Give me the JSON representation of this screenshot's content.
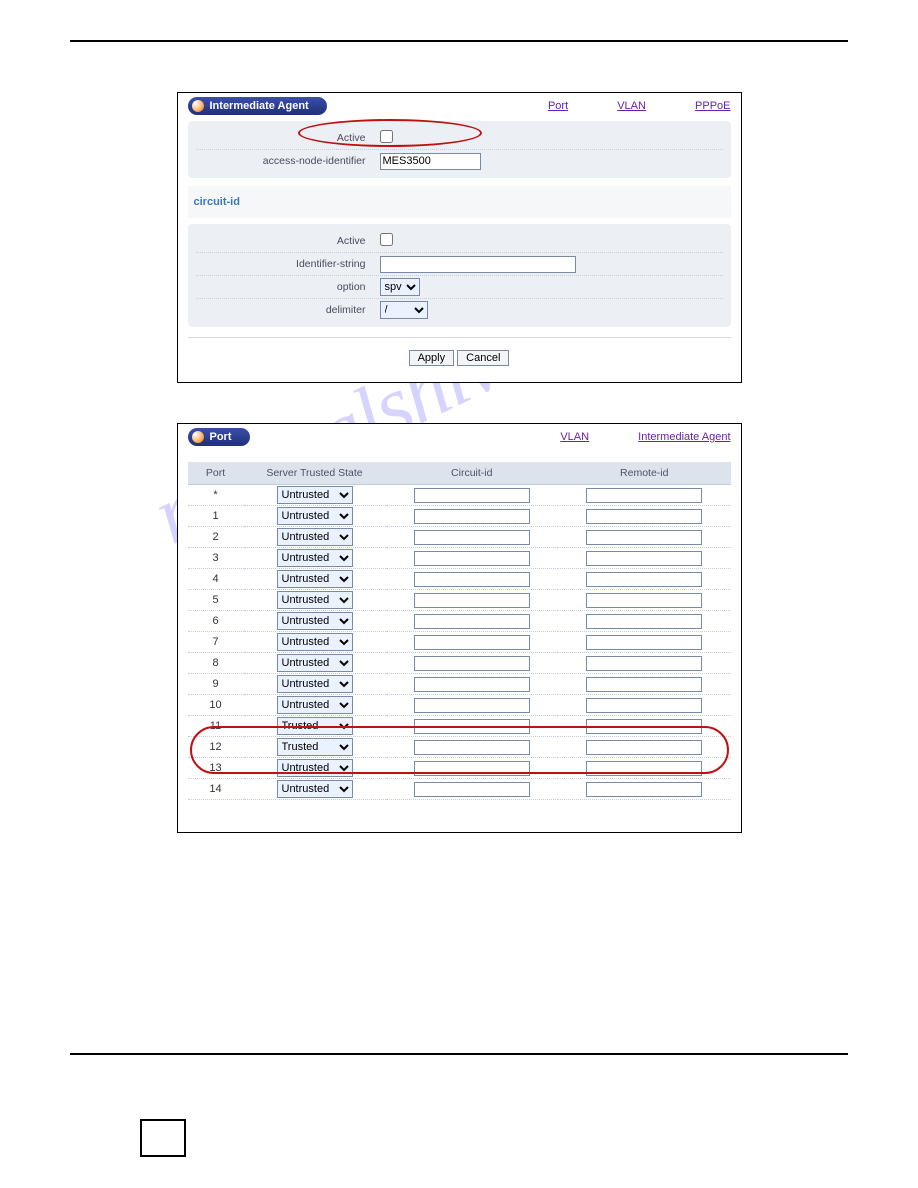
{
  "watermark": "manualshive.com",
  "panel1": {
    "title": "Intermediate Agent",
    "links": {
      "port": "Port",
      "vlan": "VLAN",
      "pppoe": "PPPoE"
    },
    "rows": {
      "active": "Active",
      "ani": "access-node-identifier",
      "ani_value": "MES3500"
    },
    "circuit_heading": "circuit-id",
    "circuit_rows": {
      "active": "Active",
      "identifier": "Identifier-string",
      "option": "option",
      "option_value": "spv",
      "delimiter": "delimiter",
      "delimiter_value": "/"
    },
    "buttons": {
      "apply": "Apply",
      "cancel": "Cancel"
    }
  },
  "panel2": {
    "title": "Port",
    "links": {
      "vlan": "VLAN",
      "ia": "Intermediate Agent"
    },
    "columns": {
      "port": "Port",
      "state": "Server Trusted State",
      "circuit": "Circuit-id",
      "remote": "Remote-id"
    },
    "states": {
      "untrusted": "Untrusted",
      "trusted": "Trusted"
    },
    "rows": [
      {
        "port": "*",
        "state": "Untrusted"
      },
      {
        "port": "1",
        "state": "Untrusted"
      },
      {
        "port": "2",
        "state": "Untrusted"
      },
      {
        "port": "3",
        "state": "Untrusted"
      },
      {
        "port": "4",
        "state": "Untrusted"
      },
      {
        "port": "5",
        "state": "Untrusted"
      },
      {
        "port": "6",
        "state": "Untrusted"
      },
      {
        "port": "7",
        "state": "Untrusted"
      },
      {
        "port": "8",
        "state": "Untrusted"
      },
      {
        "port": "9",
        "state": "Untrusted"
      },
      {
        "port": "10",
        "state": "Untrusted"
      },
      {
        "port": "11",
        "state": "Trusted"
      },
      {
        "port": "12",
        "state": "Trusted"
      },
      {
        "port": "13",
        "state": "Untrusted"
      },
      {
        "port": "14",
        "state": "Untrusted"
      }
    ]
  }
}
